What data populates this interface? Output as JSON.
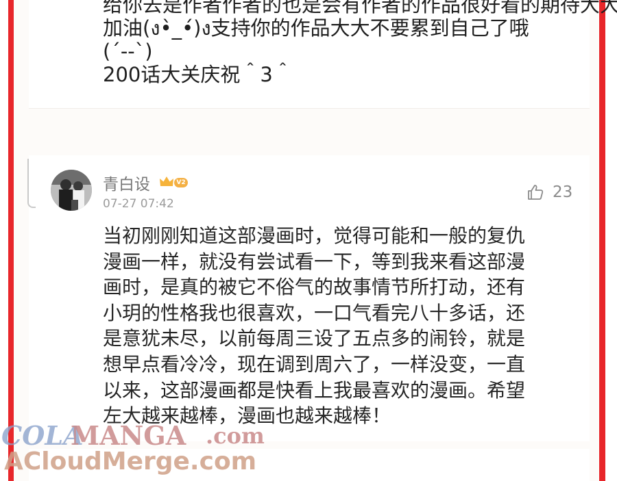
{
  "previous_comment": {
    "lines": [
      "给你去是作者作者的也是会有作者的作品很好看的期待大大",
      "加油(ง•̀_•́)ง支持你的作品大大不要累到自己了哦",
      "(´--`)",
      "200话大关庆祝＾3＾"
    ]
  },
  "comment": {
    "username": "青白设",
    "level_badge": "V2",
    "time": "07-27 07:42",
    "like_count": "23",
    "body_lines": [
      "当初刚刚知道这部漫画时，觉得可能和一般的复仇",
      "漫画一样，就没有尝试看一下，等到我来看这部漫",
      "画时，是真的被它不俗气的故事情节所打动，还有",
      "小玥的性格我也很喜欢，一口气看完八十多话，还",
      "是意犹未尽，以前每周三设了五点多的闹铃，就是",
      "想早点看冷冷，现在调到周六了，一样没变，一直",
      "以来，这部漫画都是快看上我最喜欢的漫画。希望",
      "左大越来越棒，漫画也越来越棒！"
    ]
  },
  "watermark": {
    "line1_a": "COLA",
    "line1_b": "MANGA",
    "line1_c": ".com",
    "line2": "ACloudMerge.com"
  },
  "colors": {
    "frame_red": "#e8262a",
    "text_dark": "#262626",
    "meta_gray": "#9b9b9b"
  }
}
